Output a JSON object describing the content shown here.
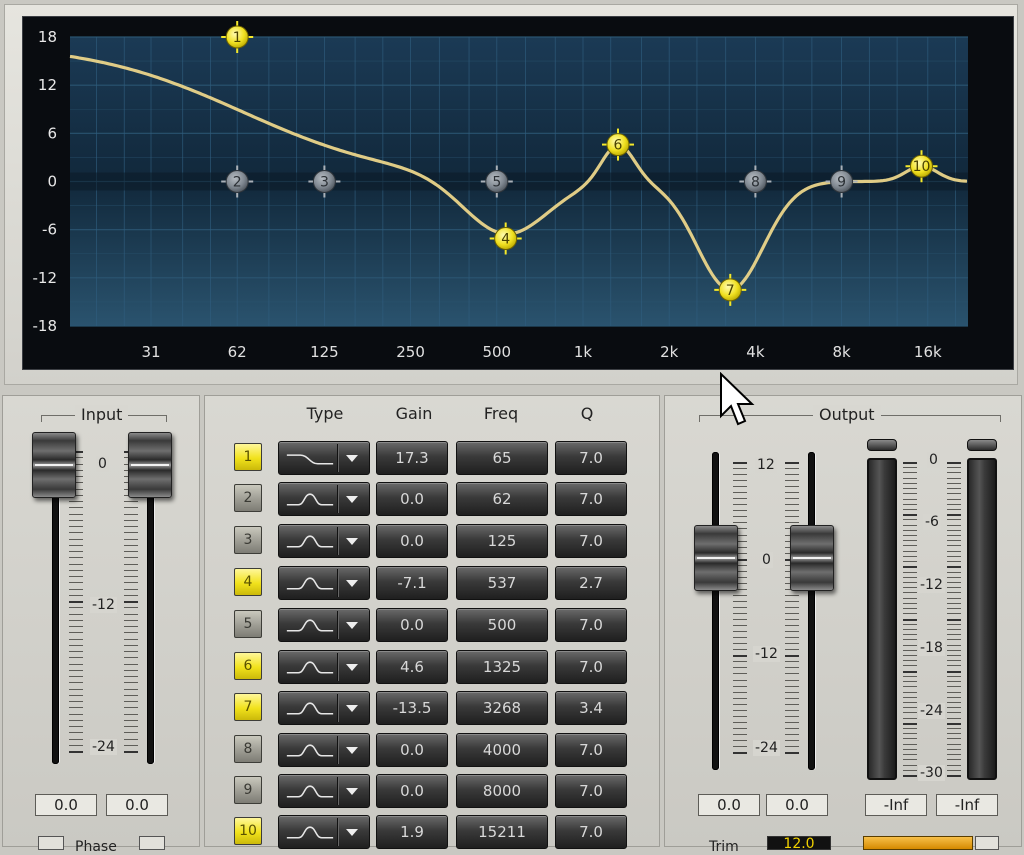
{
  "graph": {
    "y_ticks": [
      "18",
      "12",
      "6",
      "0",
      "-6",
      "-12",
      "-18"
    ],
    "x_ticks": [
      "31",
      "62",
      "125",
      "250",
      "500",
      "1k",
      "2k",
      "4k",
      "8k",
      "16k"
    ],
    "bands": [
      {
        "label": "1",
        "active": true
      },
      {
        "label": "2",
        "active": false
      },
      {
        "label": "3",
        "active": false
      },
      {
        "label": "4",
        "active": true
      },
      {
        "label": "5",
        "active": false
      },
      {
        "label": "6",
        "active": true
      },
      {
        "label": "7",
        "active": true
      },
      {
        "label": "8",
        "active": false
      },
      {
        "label": "9",
        "active": false
      },
      {
        "label": "10",
        "active": true
      }
    ]
  },
  "input": {
    "title": "Input",
    "scale": [
      "0",
      "-12",
      "-24"
    ],
    "values": [
      "0.0",
      "0.0"
    ],
    "phase_label": "Phase"
  },
  "band_table": {
    "headers": {
      "type": "Type",
      "gain": "Gain",
      "freq": "Freq",
      "q": "Q"
    },
    "rows": [
      {
        "num": "1",
        "active": true,
        "shape": "low-shelf",
        "gain": "17.3",
        "freq": "65",
        "q": "7.0"
      },
      {
        "num": "2",
        "active": false,
        "shape": "bell",
        "gain": "0.0",
        "freq": "62",
        "q": "7.0"
      },
      {
        "num": "3",
        "active": false,
        "shape": "bell",
        "gain": "0.0",
        "freq": "125",
        "q": "7.0"
      },
      {
        "num": "4",
        "active": true,
        "shape": "bell",
        "gain": "-7.1",
        "freq": "537",
        "q": "2.7"
      },
      {
        "num": "5",
        "active": false,
        "shape": "bell",
        "gain": "0.0",
        "freq": "500",
        "q": "7.0"
      },
      {
        "num": "6",
        "active": true,
        "shape": "bell",
        "gain": "4.6",
        "freq": "1325",
        "q": "7.0"
      },
      {
        "num": "7",
        "active": true,
        "shape": "bell",
        "gain": "-13.5",
        "freq": "3268",
        "q": "3.4"
      },
      {
        "num": "8",
        "active": false,
        "shape": "bell",
        "gain": "0.0",
        "freq": "4000",
        "q": "7.0"
      },
      {
        "num": "9",
        "active": false,
        "shape": "bell",
        "gain": "0.0",
        "freq": "8000",
        "q": "7.0"
      },
      {
        "num": "10",
        "active": true,
        "shape": "bell",
        "gain": "1.9",
        "freq": "15211",
        "q": "7.0"
      }
    ]
  },
  "output": {
    "title": "Output",
    "fader_scale": [
      "12",
      "0",
      "-12",
      "-24"
    ],
    "meter_scale": [
      "0",
      "-6",
      "-12",
      "-18",
      "-24",
      "-30"
    ],
    "fader_values": [
      "0.0",
      "0.0"
    ],
    "meter_values": [
      "-Inf",
      "-Inf"
    ],
    "trim_label": "Trim",
    "trim_value": "12.0"
  },
  "colors": {
    "curve": "#ebd58a",
    "node_active": "#f0e020",
    "node_inactive": "#7f8790",
    "grid": "#2f5d7e"
  },
  "icons": [
    "bell-shape-icon",
    "low-shelf-shape-icon",
    "dropdown-arrow-icon",
    "mouse-cursor-icon"
  ]
}
